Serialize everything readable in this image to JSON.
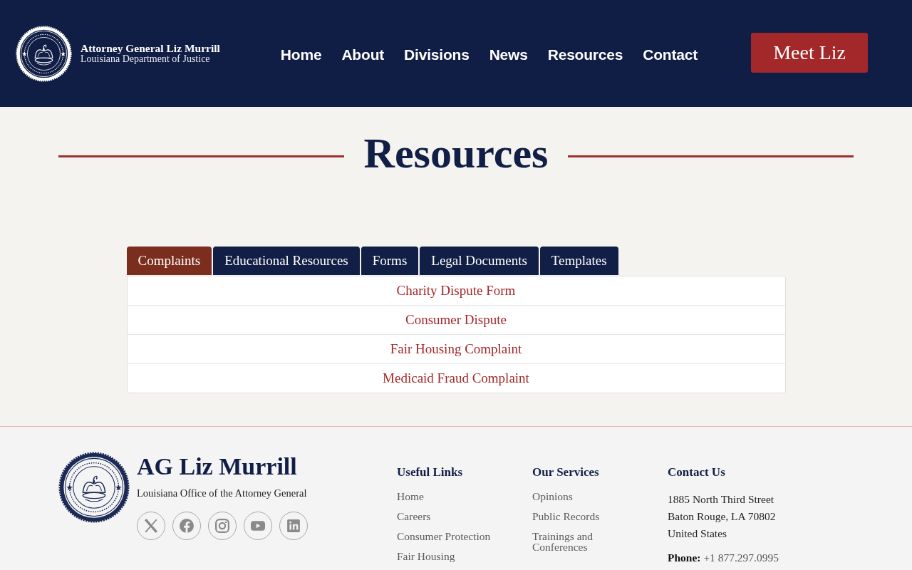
{
  "header": {
    "brand": {
      "title": "Attorney General Liz Murrill",
      "subtitle": "Louisiana Department of Justice"
    },
    "nav": [
      "Home",
      "About",
      "Divisions",
      "News",
      "Resources",
      "Contact"
    ],
    "cta": "Meet Liz"
  },
  "page": {
    "title": "Resources"
  },
  "tabs": [
    {
      "label": "Complaints",
      "selected": true
    },
    {
      "label": "Educational Resources",
      "selected": false
    },
    {
      "label": "Forms",
      "selected": false
    },
    {
      "label": "Legal Documents",
      "selected": false
    },
    {
      "label": "Templates",
      "selected": false
    }
  ],
  "resources": [
    "Charity Dispute Form",
    "Consumer Dispute",
    "Fair Housing Complaint",
    "Medicaid Fraud Complaint"
  ],
  "footer": {
    "brand": {
      "title": "AG Liz Murrill",
      "subtitle": "Louisiana Office of the Attorney General"
    },
    "columns": [
      {
        "heading": "Useful Links",
        "links": [
          "Home",
          "Careers",
          "Consumer Protection",
          "Fair Housing"
        ]
      },
      {
        "heading": "Our Services",
        "links": [
          "Opinions",
          "Public Records",
          "Trainings and Conferences"
        ]
      }
    ],
    "contact": {
      "heading": "Contact Us",
      "address": [
        "1885 North Third Street",
        "Baton Rouge, LA 70802",
        "United States"
      ],
      "phone": "**Phone:** +1 877.297.0995"
    }
  }
}
